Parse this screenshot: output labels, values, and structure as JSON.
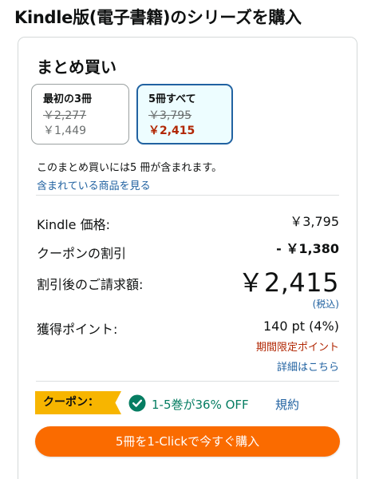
{
  "page": {
    "title": "Kindle版(電子書籍)のシリーズを購入"
  },
  "bundle": {
    "section_title": "まとめ買い",
    "options": [
      {
        "label": "最初の3冊",
        "list_price": "￥2,277",
        "price": "￥1,449",
        "selected": false
      },
      {
        "label": "5冊すべて",
        "list_price": "￥3,795",
        "price": "￥2,415",
        "selected": true
      }
    ],
    "description": "このまとめ買いには5 冊が含まれます。",
    "items_link": "含まれている商品を見る"
  },
  "summary": {
    "kindle_price_label": "Kindle 価格:",
    "kindle_price_value": "￥3,795",
    "coupon_discount_label": "クーポンの割引",
    "coupon_discount_value": "- ￥1,380",
    "total_label": "割引後のご請求額:",
    "total_value": "￥2,415",
    "tax_note": "(税込)",
    "points_label": "獲得ポイント:",
    "points_value": "140 pt (4%)",
    "points_promo": "期間限定ポイント",
    "details_link": "詳細はこちら"
  },
  "coupon": {
    "badge": "クーポン：",
    "text": "1-5巻が36% OFF",
    "terms_link": "規約",
    "icon": "check-circle-icon"
  },
  "action": {
    "buy_label": "5冊を1-Clickで今すぐ購入"
  },
  "colors": {
    "accent_blue": "#2162a1",
    "price_red": "#b12704",
    "coupon_yellow": "#f7b500",
    "coupon_green": "#067d62",
    "buy_orange": "#fa6b00"
  }
}
